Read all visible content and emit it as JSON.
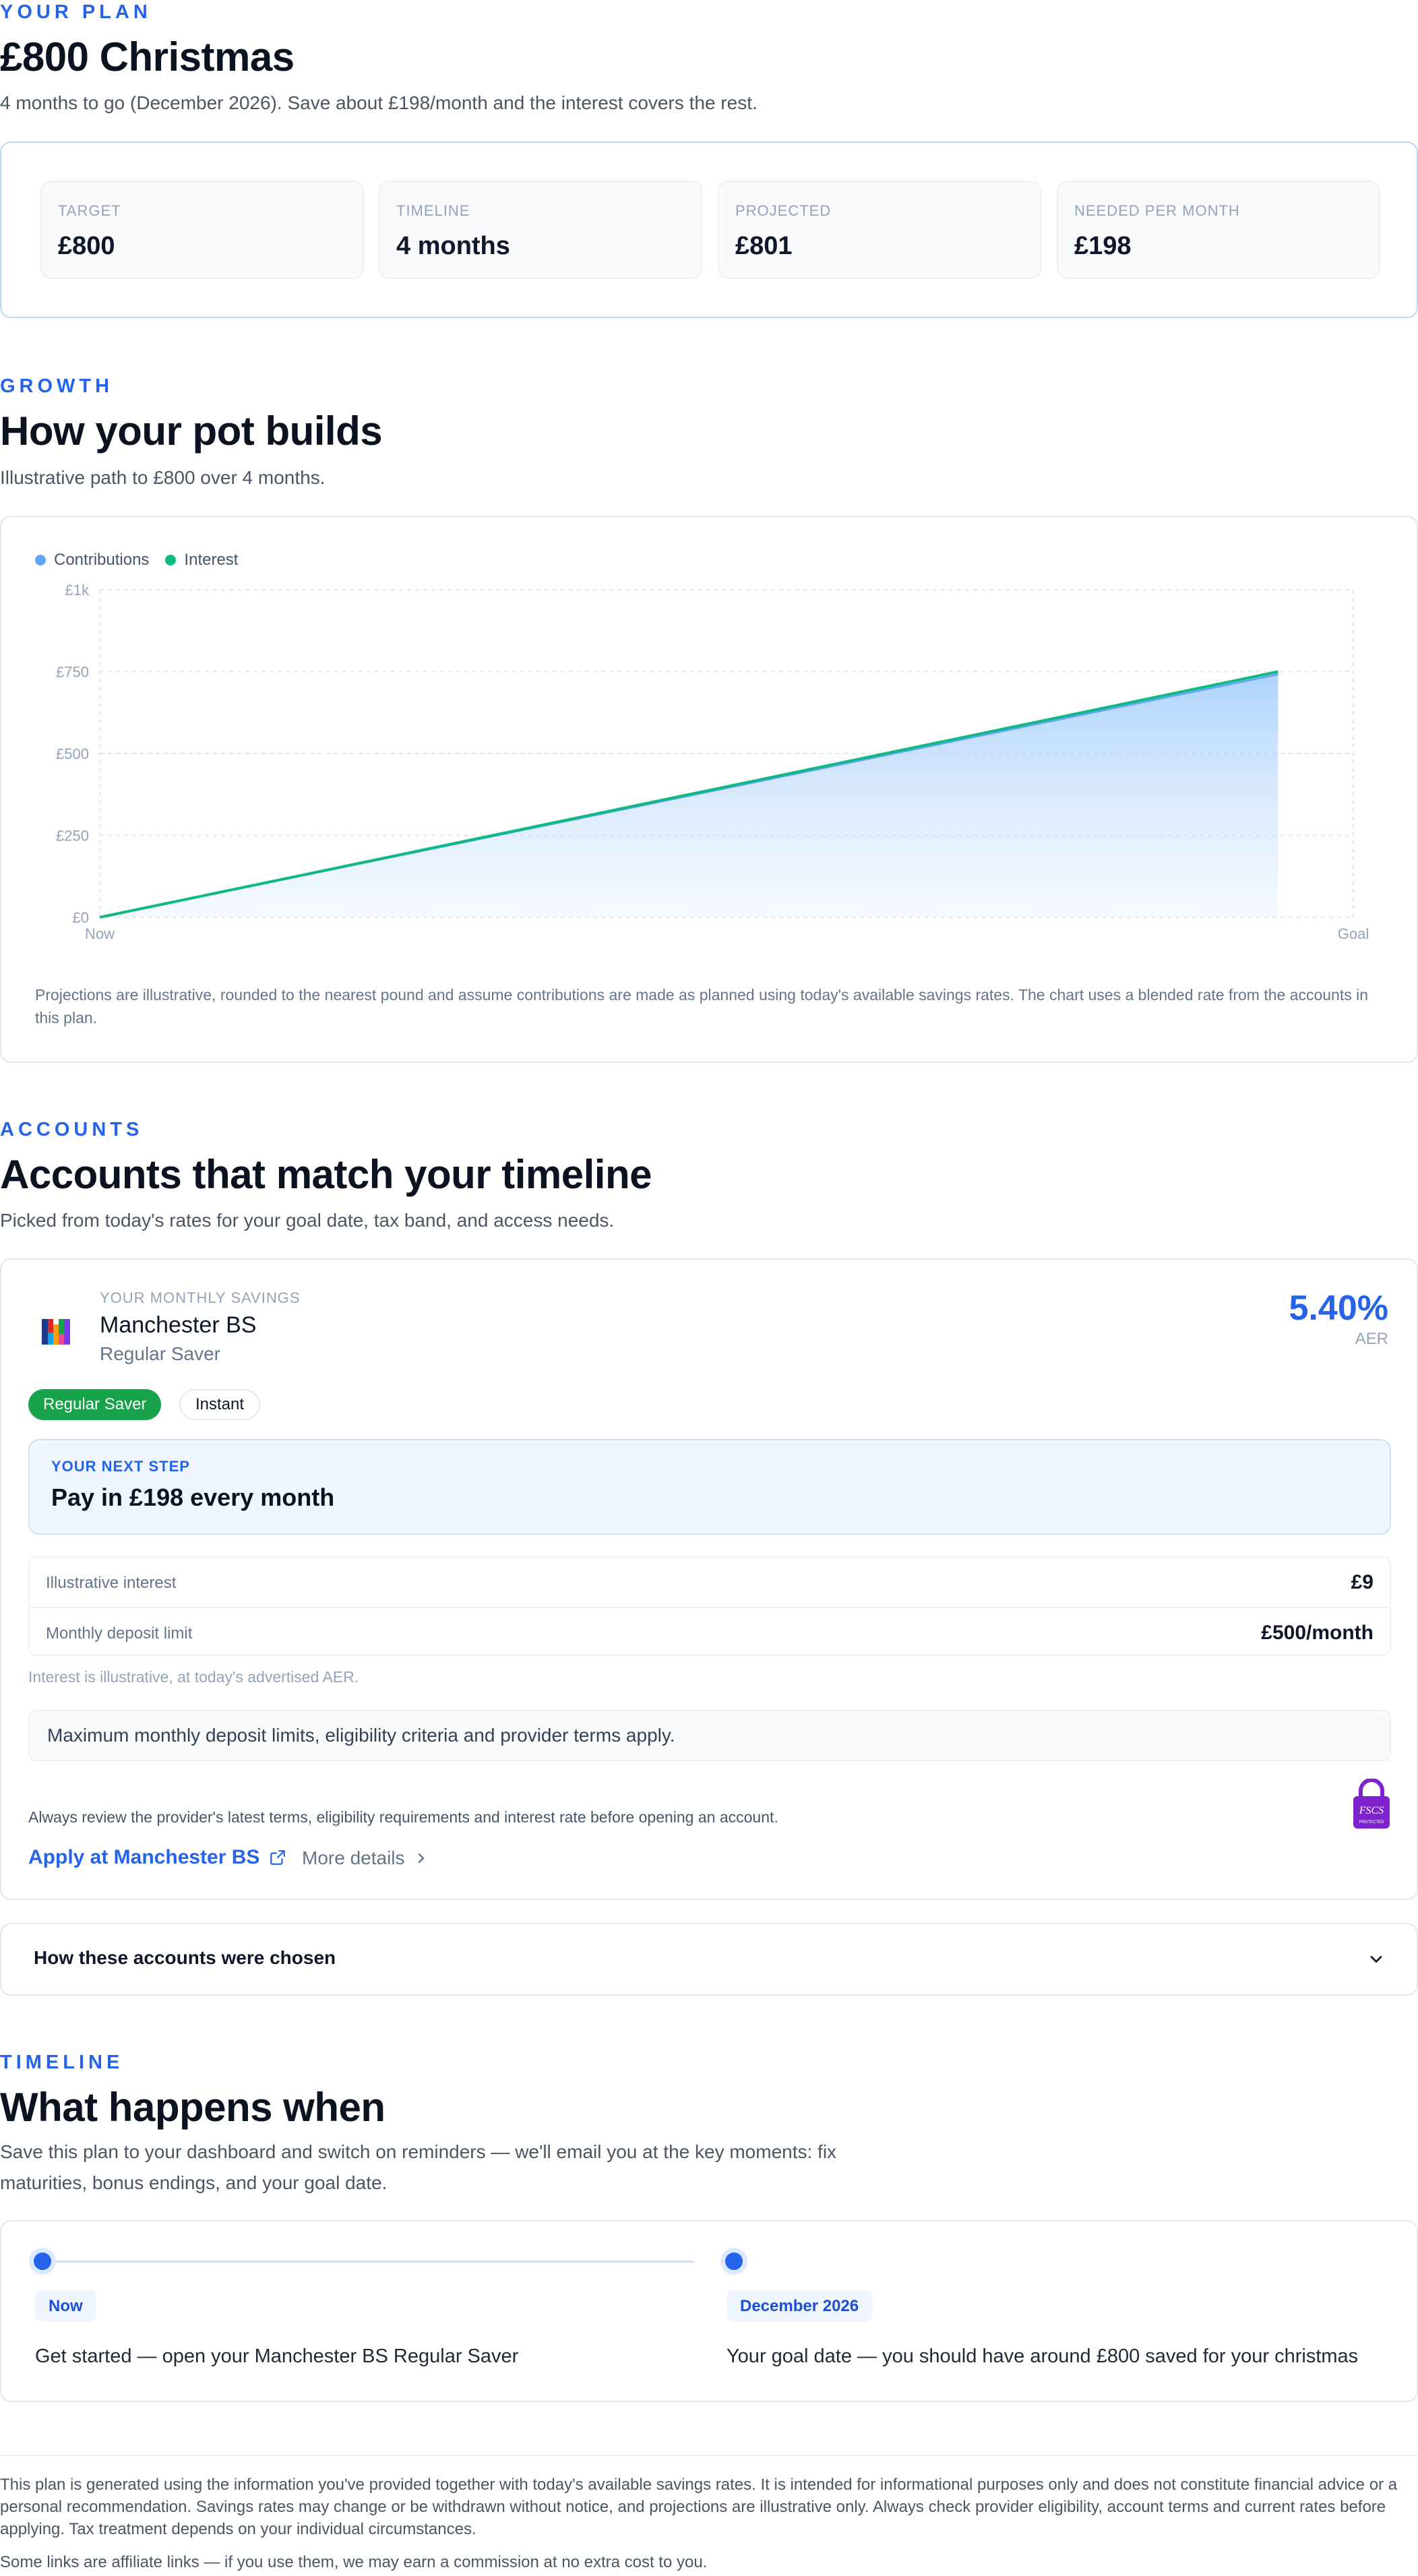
{
  "plan": {
    "eyebrow": "YOUR PLAN",
    "title": "£800 Christmas",
    "subtitle": "4 months to go (December 2026). Save about £198/month and the interest covers the rest.",
    "stats": [
      {
        "label": "TARGET",
        "value": "£800"
      },
      {
        "label": "TIMELINE",
        "value": "4 months"
      },
      {
        "label": "PROJECTED",
        "value": "£801"
      },
      {
        "label": "NEEDED PER MONTH",
        "value": "£198"
      }
    ]
  },
  "growth": {
    "eyebrow": "GROWTH",
    "title": "How your pot builds",
    "subtitle": "Illustrative path to £800 over 4 months.",
    "note": "Projections are illustrative, rounded to the nearest pound and assume contributions are made as planned using today's available savings rates. The chart uses a blended rate from the accounts in this plan."
  },
  "chart_data": {
    "type": "area",
    "title": "",
    "xlabel": "",
    "ylabel": "",
    "x_labels": [
      "Now",
      "Goal"
    ],
    "y_ticks": [
      "£0",
      "£250",
      "£500",
      "£750",
      "£1k"
    ],
    "ylim": [
      0,
      1000
    ],
    "grid": true,
    "legend_position": "top-left",
    "series": [
      {
        "name": "Contributions",
        "color": "#60a5fa",
        "points": [
          [
            0,
            0
          ],
          [
            1,
            742
          ]
        ]
      },
      {
        "name": "Interest",
        "color": "#10b981",
        "points": [
          [
            0,
            0
          ],
          [
            1,
            750
          ]
        ]
      }
    ]
  },
  "accounts": {
    "eyebrow": "ACCOUNTS",
    "title": "Accounts that match your timeline",
    "subtitle": "Picked from today's rates for your goal date, tax band, and access needs.",
    "card": {
      "label": "YOUR MONTHLY SAVINGS",
      "provider": "Manchester BS",
      "product": "Regular Saver",
      "rate": "5.40%",
      "rate_label": "AER",
      "tags": [
        "Regular Saver",
        "Instant"
      ],
      "next_step_label": "YOUR NEXT STEP",
      "next_step": "Pay in £198 every month",
      "rows": [
        {
          "label": "Illustrative interest",
          "value": "£9"
        },
        {
          "label": "Monthly deposit limit",
          "value": "£500/month"
        }
      ],
      "interest_note": "Interest is illustrative, at today's advertised AER.",
      "limits_note": "Maximum monthly deposit limits, eligibility criteria and provider terms apply.",
      "review_note": "Always review the provider's latest terms, eligibility requirements and interest rate before opening an account.",
      "apply_label": "Apply at Manchester BS",
      "more_label": "More details",
      "fscs_label": "FSCS",
      "fscs_sub": "PROTECTED"
    },
    "accordion_title": "How these accounts were chosen"
  },
  "timeline": {
    "eyebrow": "TIMELINE",
    "title": "What happens when",
    "subtitle": "Save this plan to your dashboard and switch on reminders — we'll email you at the key moments: fix maturities, bonus endings, and your goal date.",
    "steps": [
      {
        "when": "Now",
        "text": "Get started — open your Manchester BS Regular Saver"
      },
      {
        "when": "December 2026",
        "text": "Your goal date — you should have around £800 saved for your christmas"
      }
    ]
  },
  "footer": {
    "disclaimer": "This plan is generated using the information you've provided together with today's available savings rates. It is intended for informational purposes only and does not constitute financial advice or a personal recommendation. Savings rates may change or be withdrawn without notice, and projections are illustrative only. Always check provider eligibility, account terms and current rates before applying. Tax treatment depends on your individual circumstances.",
    "affiliate": "Some links are affiliate links — if you use them, we may earn a commission at no extra cost to you."
  }
}
